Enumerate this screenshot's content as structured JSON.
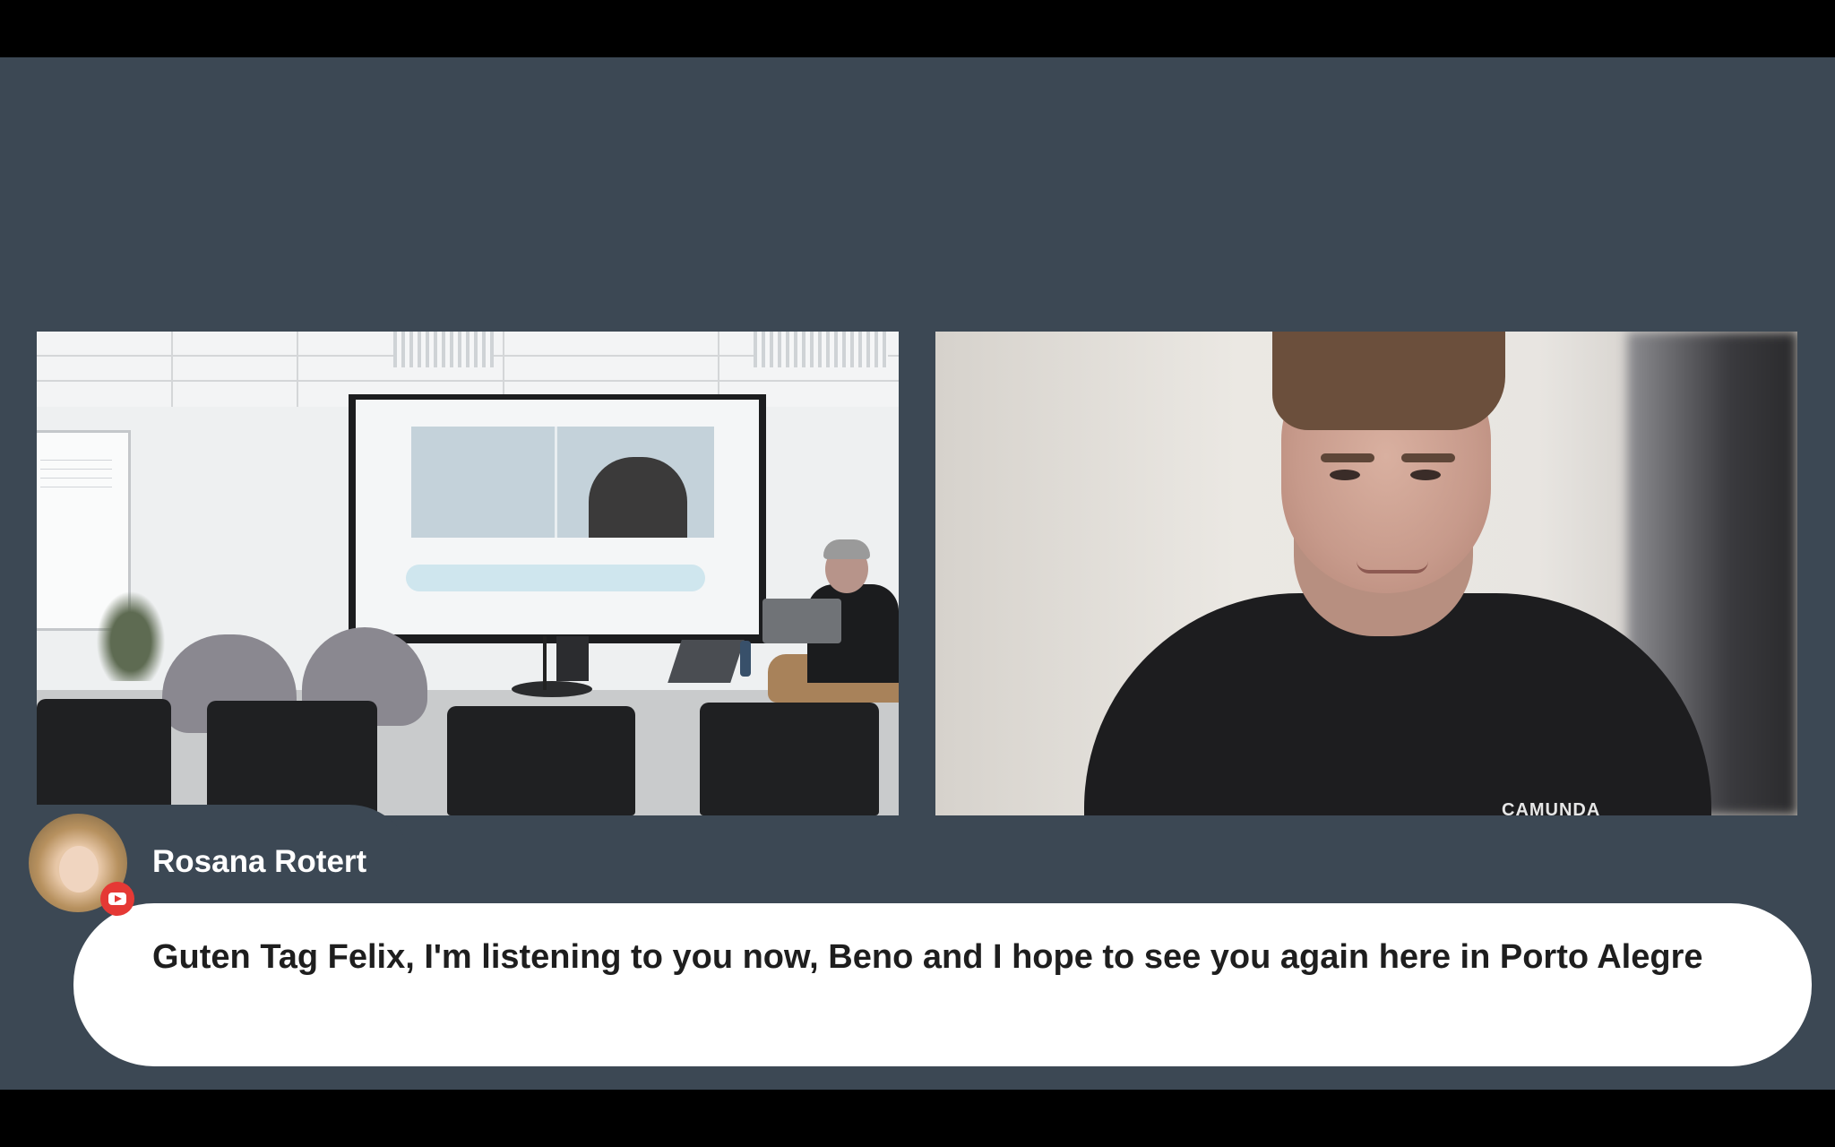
{
  "comment": {
    "author": "Rosana Rotert",
    "platform_icon": "youtube-icon",
    "text": "Guten Tag Felix, I'm listening to you now, Beno and I hope to see you again here in Porto Alegre"
  },
  "video": {
    "right_shirt_text": "CAMUNDA"
  },
  "colors": {
    "stage_background": "#3c4854",
    "letterbox": "#000000",
    "bubble": "#ffffff",
    "badge": "#e53935"
  }
}
